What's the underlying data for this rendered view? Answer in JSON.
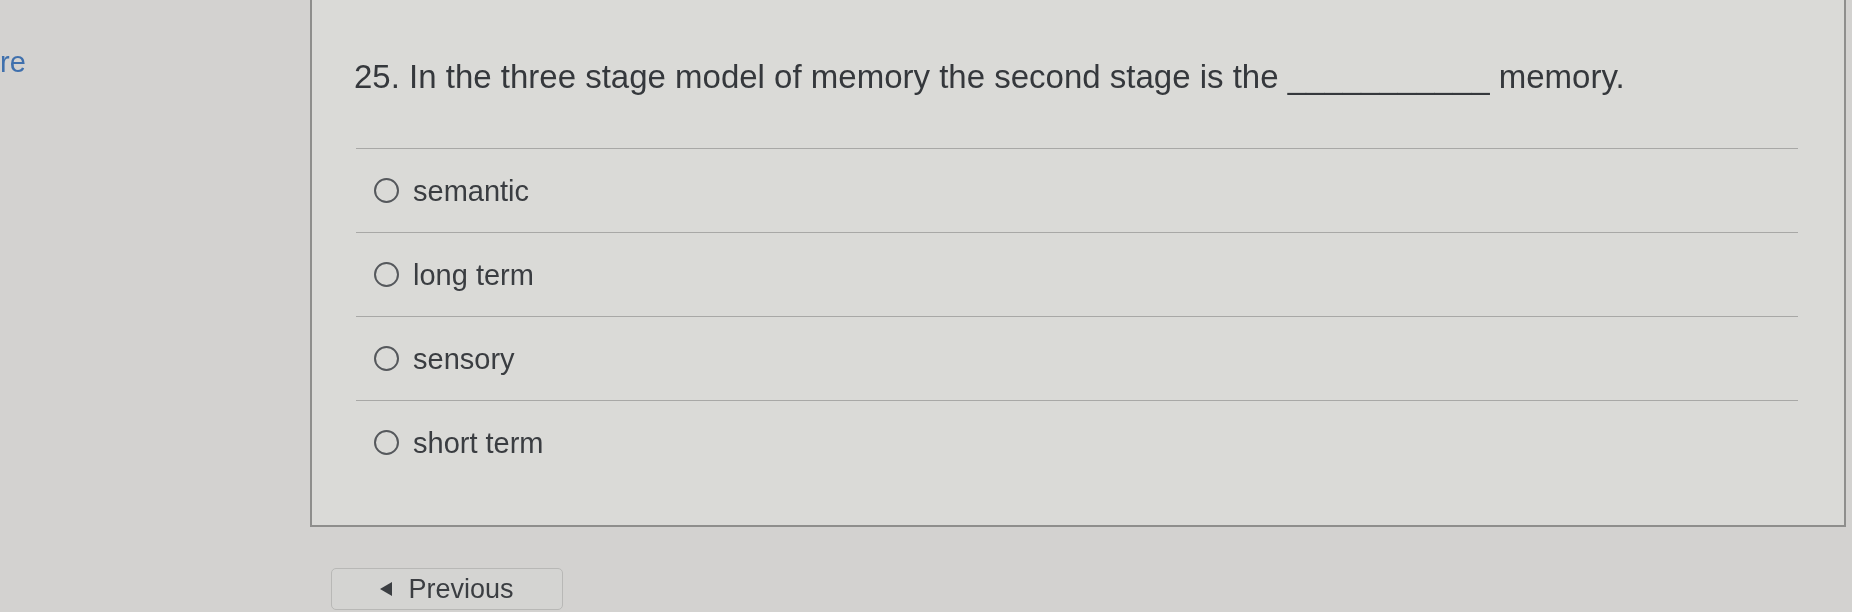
{
  "sidebar": {
    "link_text": "re"
  },
  "question": {
    "text": "25. In the three stage model of memory the second stage is the ___________ memory.",
    "options": [
      {
        "label": "semantic",
        "selected": false
      },
      {
        "label": "long term",
        "selected": false
      },
      {
        "label": "sensory",
        "selected": false
      },
      {
        "label": "short term",
        "selected": false
      }
    ]
  },
  "navigation": {
    "previous": {
      "label": "Previous"
    }
  }
}
